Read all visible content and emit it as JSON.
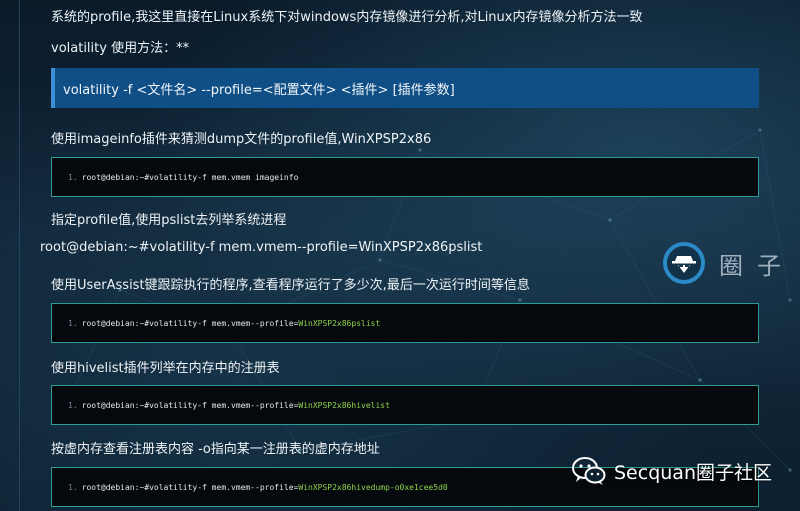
{
  "article": {
    "intro_line": "系统的profile,我这里直接在Linux系统下对windows内存镜像进行分析,对Linux内存镜像分析方法一致",
    "usage_heading": "volatility 使用方法：**",
    "usage_syntax": "volatility -f <文件名> --profile=<配置文件> <插件> [插件参数]",
    "step1_text": "使用imageinfo插件来猜测dump文件的profile值,WinXPSP2x86",
    "step1_code": {
      "line_number": "1.",
      "command": "root@debian:~#volatility-f mem.vmem imageinfo"
    },
    "step2_text": "指定profile值,使用pslist去列举系统进程",
    "step2_plain": "root@debian:~#volatility-f mem.vmem--profile=WinXPSP2x86pslist",
    "step3_text": "使用UserAssist键跟踪执行的程序,查看程序运行了多少次,最后一次运行时间等信息",
    "step3_code": {
      "line_number": "1.",
      "command": "root@debian:~#volatility-f mem.vmem--profile=",
      "highlight": "WinXPSP2x86pslist"
    },
    "step4_text": "使用hivelist插件列举在内存中的注册表",
    "step4_code": {
      "line_number": "1.",
      "command": "root@debian:~#volatility-f mem.vmem--profile=",
      "highlight": "WinXPSP2x86hivelist"
    },
    "step5_text": "按虚内存查看注册表内容 -o指向某一注册表的虚内存地址",
    "step5_code": {
      "line_number": "1.",
      "command": "root@debian:~#volatility-f mem.vmem--profile=",
      "highlight": "WinXPSP2x86hivedump-o0xe1cee5d0"
    }
  },
  "watermark": {
    "text": "圈子",
    "icon": "hacker-hat-icon"
  },
  "footer": {
    "brand": "Secquan圈子社区",
    "icon": "wechat-icon"
  },
  "colors": {
    "quote_bg": "#0f4f86",
    "code_border": "#2e9c93",
    "highlight": "#8fd44a"
  }
}
